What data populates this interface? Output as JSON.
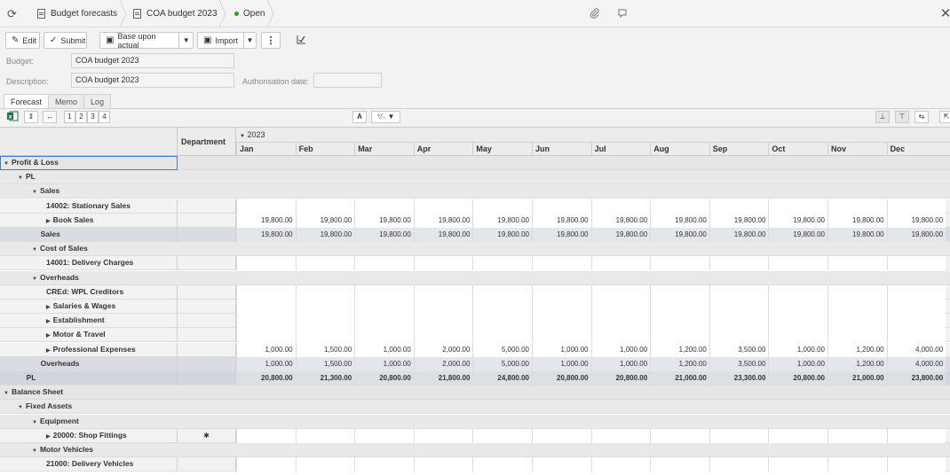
{
  "topbar": {
    "crumbs": [
      "Budget forecasts",
      "COA budget 2023"
    ],
    "status": "Open",
    "icons": [
      "refresh-icon",
      "paperclip-icon",
      "comment-icon",
      "close-icon"
    ]
  },
  "toolbar": {
    "edit": "Edit",
    "submit": "Submit",
    "base_upon_actual": "Base upon actual",
    "import": "Import"
  },
  "form": {
    "budget_label": "Budget:",
    "budget_value": "COA budget 2023",
    "description_label": "Description:",
    "description_value": "COA budget 2023",
    "authorisation_label": "Authorisation date:",
    "authorisation_value": ""
  },
  "tabs": [
    "Forecast",
    "Memo",
    "Log"
  ],
  "grid_toolbar": {
    "levels": [
      "1",
      "2",
      "3",
      "4"
    ]
  },
  "grid": {
    "department_header": "Department",
    "year": "2023",
    "months": [
      "Jan",
      "Feb",
      "Mar",
      "Apr",
      "May",
      "Jun",
      "Jul",
      "Aug",
      "Sep",
      "Oct",
      "Nov",
      "Dec"
    ],
    "rows": [
      {
        "label": "Profit & Loss",
        "indent": 0,
        "tri": "▼",
        "kind": "group",
        "dept": "",
        "values": null
      },
      {
        "label": "PL",
        "indent": 1,
        "tri": "▼",
        "kind": "sub",
        "dept": "",
        "values": null
      },
      {
        "label": "Sales",
        "indent": 2,
        "tri": "▼",
        "kind": "sub",
        "dept": "",
        "values": null
      },
      {
        "label": "14002: Stationary Sales",
        "indent": 3,
        "tri": "",
        "kind": "leaf",
        "dept": "",
        "values": [
          "",
          "",
          "",
          "",
          "",
          "",
          "",
          "",
          "",
          "",
          "",
          ""
        ]
      },
      {
        "label": "Book Sales",
        "indent": 3,
        "tri": "▶",
        "kind": "leaf",
        "dept": "",
        "values": [
          "19,800.00",
          "19,800.00",
          "19,800.00",
          "19,800.00",
          "19,800.00",
          "19,800.00",
          "19,800.00",
          "19,800.00",
          "19,800.00",
          "19,800.00",
          "19,800.00",
          "19,800.00"
        ]
      },
      {
        "label": "Sales",
        "indent": 2.6,
        "tri": "",
        "kind": "total",
        "dept": "",
        "values": [
          "19,800.00",
          "19,800.00",
          "19,800.00",
          "19,800.00",
          "19,800.00",
          "19,800.00",
          "19,800.00",
          "19,800.00",
          "19,800.00",
          "19,800.00",
          "19,800.00",
          "19,800.00"
        ]
      },
      {
        "label": "Cost of Sales",
        "indent": 2,
        "tri": "▼",
        "kind": "sub",
        "dept": "",
        "values": null
      },
      {
        "label": "14001: Delivery Charges",
        "indent": 3,
        "tri": "",
        "kind": "leaf",
        "dept": "",
        "values": [
          "",
          "",
          "",
          "",
          "",
          "",
          "",
          "",
          "",
          "",
          "",
          ""
        ]
      },
      {
        "label": "Overheads",
        "indent": 2,
        "tri": "▼",
        "kind": "sub",
        "dept": "",
        "values": null
      },
      {
        "label": "CREd: WPL Creditors",
        "indent": 3,
        "tri": "",
        "kind": "leaf",
        "dept": "",
        "values": [
          "",
          "",
          "",
          "",
          "",
          "",
          "",
          "",
          "",
          "",
          "",
          ""
        ]
      },
      {
        "label": "Salaries & Wages",
        "indent": 3,
        "tri": "▶",
        "kind": "leaf",
        "dept": "",
        "values": [
          "",
          "",
          "",
          "",
          "",
          "",
          "",
          "",
          "",
          "",
          "",
          ""
        ]
      },
      {
        "label": "Establishment",
        "indent": 3,
        "tri": "▶",
        "kind": "leaf",
        "dept": "",
        "values": [
          "",
          "",
          "",
          "",
          "",
          "",
          "",
          "",
          "",
          "",
          "",
          ""
        ]
      },
      {
        "label": "Motor & Travel",
        "indent": 3,
        "tri": "▶",
        "kind": "leaf",
        "dept": "",
        "values": [
          "",
          "",
          "",
          "",
          "",
          "",
          "",
          "",
          "",
          "",
          "",
          ""
        ]
      },
      {
        "label": "Professional Expenses",
        "indent": 3,
        "tri": "▶",
        "kind": "leaf",
        "dept": "",
        "values": [
          "1,000.00",
          "1,500.00",
          "1,000.00",
          "2,000.00",
          "5,000.00",
          "1,000.00",
          "1,000.00",
          "1,200.00",
          "3,500.00",
          "1,000.00",
          "1,200.00",
          "4,000.00"
        ]
      },
      {
        "label": "Overheads",
        "indent": 2.6,
        "tri": "",
        "kind": "total",
        "dept": "",
        "values": [
          "1,000.00",
          "1,500.00",
          "1,000.00",
          "2,000.00",
          "5,000.00",
          "1,000.00",
          "1,000.00",
          "1,200.00",
          "3,500.00",
          "1,000.00",
          "1,200.00",
          "4,000.00"
        ]
      },
      {
        "label": "PL",
        "indent": 1.6,
        "tri": "",
        "kind": "grand",
        "dept": "",
        "values": [
          "20,800.00",
          "21,300.00",
          "20,800.00",
          "21,800.00",
          "24,800.00",
          "20,800.00",
          "20,800.00",
          "21,000.00",
          "23,300.00",
          "20,800.00",
          "21,000.00",
          "23,800.00"
        ]
      },
      {
        "label": "Balance Sheet",
        "indent": 0,
        "tri": "▼",
        "kind": "group",
        "dept": "",
        "values": null
      },
      {
        "label": "Fixed Assets",
        "indent": 1,
        "tri": "▼",
        "kind": "sub",
        "dept": "",
        "values": null
      },
      {
        "label": "Equipment",
        "indent": 2,
        "tri": "▼",
        "kind": "sub",
        "dept": "",
        "values": null
      },
      {
        "label": "20000: Shop Fittings",
        "indent": 3,
        "tri": "▶",
        "kind": "leaf",
        "dept": "✱",
        "values": [
          "",
          "",
          "",
          "",
          "",
          "",
          "",
          "",
          "",
          "",
          "",
          ""
        ]
      },
      {
        "label": "Motor Vehicles",
        "indent": 2,
        "tri": "▼",
        "kind": "sub",
        "dept": "",
        "values": null
      },
      {
        "label": "21000: Delivery Vehicles",
        "indent": 3,
        "tri": "",
        "kind": "leaf",
        "dept": "",
        "values": [
          "",
          "",
          "",
          "",
          "",
          "",
          "",
          "",
          "",
          "",
          "",
          ""
        ]
      }
    ]
  }
}
